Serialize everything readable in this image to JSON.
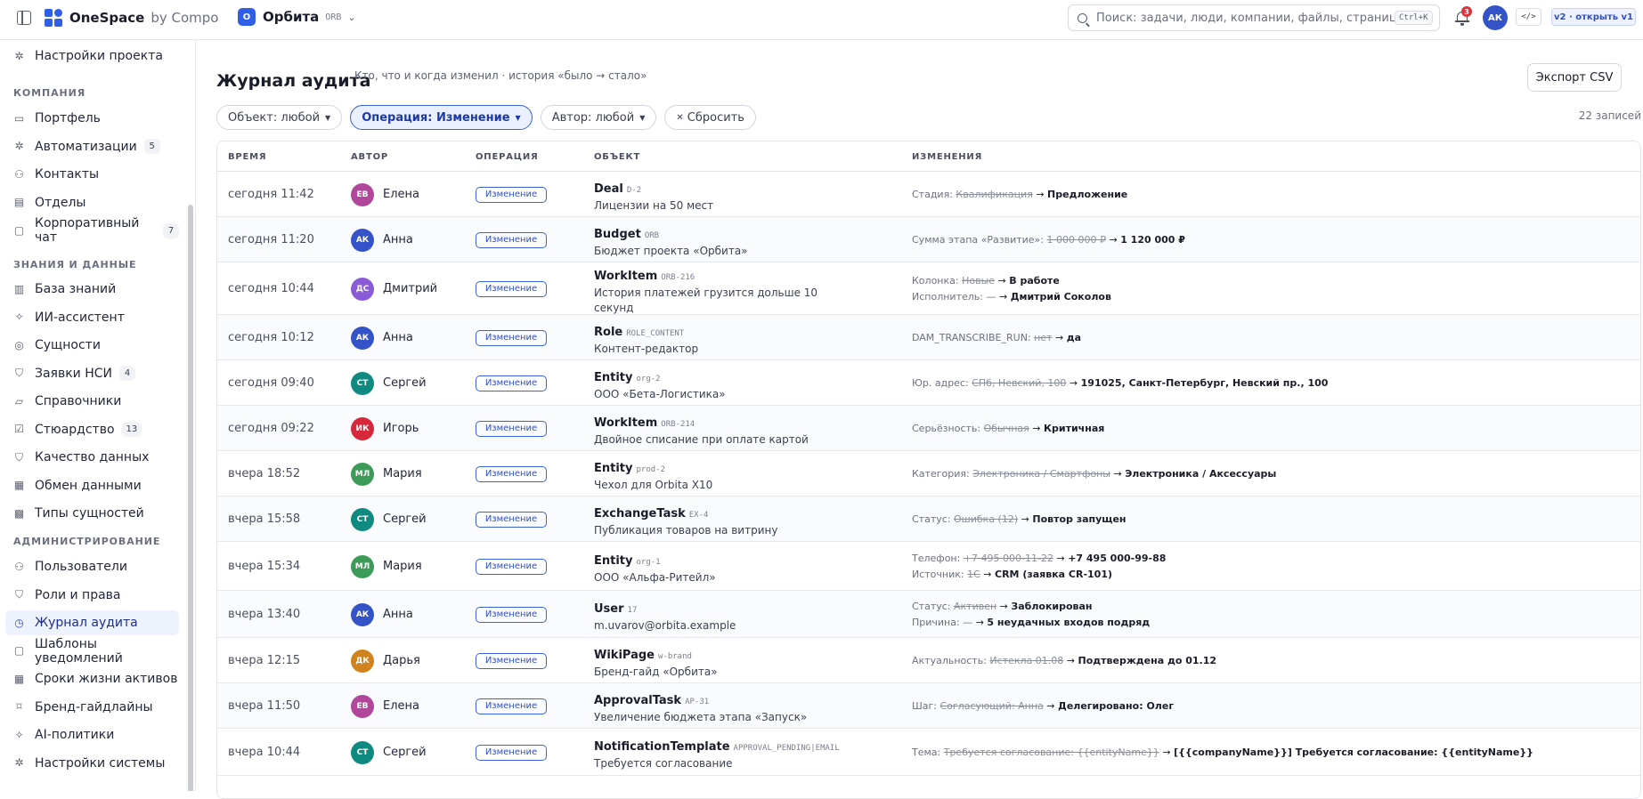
{
  "topbar": {
    "brand": "OneSpace",
    "brand_by": "by Compo",
    "project_badge": "О",
    "project_name": "Орбита",
    "project_code": "ORB",
    "search_placeholder": "Поиск: задачи, люди, компании, файлы, страниц",
    "search_shortcut": "Ctrl+K",
    "notifications_count": "3",
    "user_initials": "АК",
    "code_label": "</>",
    "version_label": "v2 · открыть v1",
    "accent": "#2f5fe6"
  },
  "sidebar": {
    "top_item": {
      "label": "Настройки проекта",
      "icon": "gear-icon"
    },
    "sections": [
      {
        "title": "КОМПАНИЯ",
        "items": [
          {
            "label": "Портфель",
            "icon": "briefcase-icon"
          },
          {
            "label": "Автоматизации",
            "icon": "gear-icon",
            "badge": "5"
          },
          {
            "label": "Контакты",
            "icon": "users-icon"
          },
          {
            "label": "Отделы",
            "icon": "building-icon"
          },
          {
            "label": "Корпоративный чат",
            "icon": "chat-icon",
            "badge": "7"
          }
        ]
      },
      {
        "title": "ЗНАНИЯ И ДАННЫЕ",
        "items": [
          {
            "label": "База знаний",
            "icon": "document-icon"
          },
          {
            "label": "ИИ-ассистент",
            "icon": "sparkle-icon"
          },
          {
            "label": "Сущности",
            "icon": "database-icon"
          },
          {
            "label": "Заявки НСИ",
            "icon": "shield-icon",
            "badge": "4"
          },
          {
            "label": "Справочники",
            "icon": "folder-icon"
          },
          {
            "label": "Стюардство",
            "icon": "check-circle-icon",
            "badge": "13"
          },
          {
            "label": "Качество данных",
            "icon": "shield-icon"
          },
          {
            "label": "Обмен данными",
            "icon": "calendar-icon"
          },
          {
            "label": "Типы сущностей",
            "icon": "grid-icon"
          }
        ]
      },
      {
        "title": "АДМИНИСТРИРОВАНИЕ",
        "items": [
          {
            "label": "Пользователи",
            "icon": "users-icon"
          },
          {
            "label": "Роли и права",
            "icon": "shield-icon"
          },
          {
            "label": "Журнал аудита",
            "icon": "clock-icon",
            "active": true
          },
          {
            "label": "Шаблоны уведомлений",
            "icon": "chat-icon"
          },
          {
            "label": "Сроки жизни активов",
            "icon": "calendar-icon"
          },
          {
            "label": "Бренд-гайдлайны",
            "icon": "bookmark-icon"
          },
          {
            "label": "AI-политики",
            "icon": "sparkle-icon"
          },
          {
            "label": "Настройки системы",
            "icon": "gear-icon"
          }
        ]
      }
    ]
  },
  "page": {
    "title": "Журнал аудита",
    "subtitle": "Кто, что и когда изменил · история «было → стало»",
    "export_label": "Экспорт CSV",
    "filters": [
      {
        "label": "Объект: любой",
        "active": false,
        "caret": true
      },
      {
        "label": "Операция: Изменение",
        "active": true,
        "caret": true
      },
      {
        "label": "Автор: любой",
        "active": false,
        "caret": true
      },
      {
        "label": "Сбросить",
        "reset": true
      }
    ],
    "record_count": "22 записей"
  },
  "table": {
    "columns": [
      "ВРЕМЯ",
      "АВТОР",
      "ОПЕРАЦИЯ",
      "ОБЪЕКТ",
      "ИЗМЕНЕНИЯ"
    ],
    "rows": [
      {
        "time": "сегодня 11:42",
        "initials": "ЕВ",
        "color": "#b0479a",
        "author": "Елена",
        "op": "Изменение",
        "type": "Deal",
        "code": "D-2",
        "name": "Лицензии на 50 мест",
        "changes": [
          {
            "field": "Стадия:",
            "old": "Квалификация",
            "new": "Предложение"
          }
        ]
      },
      {
        "time": "сегодня 11:20",
        "initials": "АК",
        "color": "#3453c8",
        "author": "Анна",
        "op": "Изменение",
        "type": "Budget",
        "code": "ORB",
        "name": "Бюджет проекта «Орбита»",
        "changes": [
          {
            "field": "Сумма этапа «Развитие»:",
            "old": "1 000 000 ₽",
            "new": "1 120 000 ₽"
          }
        ]
      },
      {
        "time": "сегодня 10:44",
        "initials": "ДС",
        "color": "#8a5bd6",
        "author": "Дмитрий",
        "op": "Изменение",
        "type": "WorkItem",
        "code": "ORB-216",
        "name": "История платежей грузится дольше 10 секунд",
        "changes": [
          {
            "field": "Колонка:",
            "old": "Новые",
            "new": "В работе"
          },
          {
            "field": "Исполнитель:",
            "old": "—",
            "new": "Дмитрий Соколов",
            "plain_old": true
          }
        ]
      },
      {
        "time": "сегодня 10:12",
        "initials": "АК",
        "color": "#3453c8",
        "author": "Анна",
        "op": "Изменение",
        "type": "Role",
        "code": "ROLE_CONTENT",
        "name": "Контент-редактор",
        "changes": [
          {
            "field": "DAM_TRANSCRIBE_RUN:",
            "old": "нет",
            "new": "да"
          }
        ]
      },
      {
        "time": "сегодня 09:40",
        "initials": "СТ",
        "color": "#0f8a80",
        "author": "Сергей",
        "op": "Изменение",
        "type": "Entity",
        "code": "org-2",
        "name": "ООО «Бета-Логистика»",
        "changes": [
          {
            "field": "Юр. адрес:",
            "old": "СПб, Невский, 100",
            "new": "191025, Санкт-Петербург, Невский пр., 100"
          }
        ]
      },
      {
        "time": "сегодня 09:22",
        "initials": "ИК",
        "color": "#d6283a",
        "author": "Игорь",
        "op": "Изменение",
        "type": "WorkItem",
        "code": "ORB-214",
        "name": "Двойное списание при оплате картой",
        "changes": [
          {
            "field": "Серьёзность:",
            "old": "Обычная",
            "new": "Критичная"
          }
        ]
      },
      {
        "time": "вчера 18:52",
        "initials": "МЛ",
        "color": "#3d9b5a",
        "author": "Мария",
        "op": "Изменение",
        "type": "Entity",
        "code": "prod-2",
        "name": "Чехол для Orbita X10",
        "changes": [
          {
            "field": "Категория:",
            "old": "Электроника / Смартфоны",
            "new": "Электроника / Аксессуары"
          }
        ]
      },
      {
        "time": "вчера 15:58",
        "initials": "СТ",
        "color": "#0f8a80",
        "author": "Сергей",
        "op": "Изменение",
        "type": "ExchangeTask",
        "code": "EX-4",
        "name": "Публикация товаров на витрину",
        "changes": [
          {
            "field": "Статус:",
            "old": "Ошибка (12)",
            "new": "Повтор запущен"
          }
        ]
      },
      {
        "time": "вчера 15:34",
        "initials": "МЛ",
        "color": "#3d9b5a",
        "author": "Мария",
        "op": "Изменение",
        "type": "Entity",
        "code": "org-1",
        "name": "ООО «Альфа-Ритейл»",
        "changes": [
          {
            "field": "Телефон:",
            "old": "+7 495 000-11-22",
            "new": "+7 495 000-99-88"
          },
          {
            "field": "Источник:",
            "old": "1С",
            "new": "CRM (заявка CR-101)"
          }
        ]
      },
      {
        "time": "вчера 13:40",
        "initials": "АК",
        "color": "#3453c8",
        "author": "Анна",
        "op": "Изменение",
        "type": "User",
        "code": "17",
        "name": "m.uvarov@orbita.example",
        "changes": [
          {
            "field": "Статус:",
            "old": "Активен",
            "new": "Заблокирован"
          },
          {
            "field": "Причина:",
            "old": "—",
            "new": "5 неудачных входов подряд",
            "plain_old": true
          }
        ]
      },
      {
        "time": "вчера 12:15",
        "initials": "ДК",
        "color": "#d0821c",
        "author": "Дарья",
        "op": "Изменение",
        "type": "WikiPage",
        "code": "w-brand",
        "name": "Бренд-гайд «Орбита»",
        "changes": [
          {
            "field": "Актуальность:",
            "old": "Истекла 01.08",
            "new": "Подтверждена до 01.12"
          }
        ]
      },
      {
        "time": "вчера 11:50",
        "initials": "ЕВ",
        "color": "#b0479a",
        "author": "Елена",
        "op": "Изменение",
        "type": "ApprovalTask",
        "code": "AP-31",
        "name": "Увеличение бюджета этапа «Запуск»",
        "changes": [
          {
            "field": "Шаг:",
            "old": "Согласующий: Анна",
            "new": "Делегировано: Олег"
          }
        ]
      },
      {
        "time": "вчера 10:44",
        "initials": "СТ",
        "color": "#0f8a80",
        "author": "Сергей",
        "op": "Изменение",
        "type": "NotificationTemplate",
        "code": "APPROVAL_PENDING|EMAIL",
        "name": "Требуется согласование",
        "changes": [
          {
            "field": "Тема:",
            "old": "Требуется согласование: {{entityName}}",
            "new": "[{{companyName}}] Требуется согласование: {{entityName}}"
          }
        ]
      }
    ]
  }
}
